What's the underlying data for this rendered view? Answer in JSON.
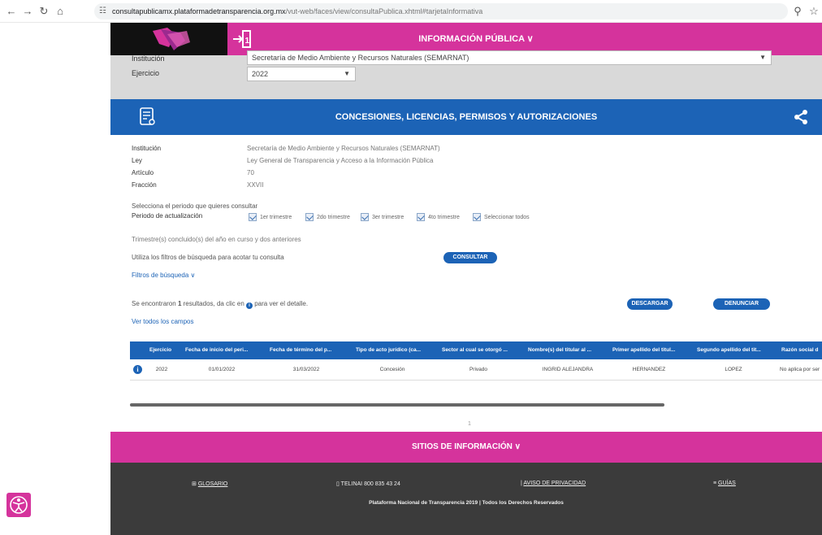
{
  "browser": {
    "url_host": "consultapublicamx.plataformadetransparencia.org.mx",
    "url_path": "/vut-web/faces/view/consultaPublica.xhtml#tarjetaInformativa"
  },
  "header": {
    "title": "INFORMACIÓN PÚBLICA ∨"
  },
  "filters": {
    "institucion_label": "Institución",
    "institucion_value": "Secretaría de Medio Ambiente y Recursos Naturales (SEMARNAT)",
    "ejercicio_label": "Ejercicio",
    "ejercicio_value": "2022"
  },
  "card": {
    "title": "CONCESIONES, LICENCIAS, PERMISOS Y AUTORIZACIONES",
    "institucion_k": "Institución",
    "institucion_v": "Secretaría de Medio Ambiente y Recursos Naturales (SEMARNAT)",
    "ley_k": "Ley",
    "ley_v": "Ley General de Transparencia y Acceso a la Información Pública",
    "articulo_k": "Artículo",
    "articulo_v": "70",
    "fraccion_k": "Fracción",
    "fraccion_v": "XXVII"
  },
  "period": {
    "prompt": "Selecciona el periodo que quieres consultar",
    "label": "Periodo de actualización",
    "options": [
      "1er trimestre",
      "2do trimestre",
      "3er trimestre",
      "4to trimestre",
      "Seleccionar todos"
    ],
    "note": "Trimestre(s) concluido(s) del año en curso y dos anteriores"
  },
  "search": {
    "hint": "Utiliza los filtros de búsqueda para acotar tu consulta",
    "consultar": "CONSULTAR",
    "filtros": "Filtros de búsqueda ∨"
  },
  "results": {
    "text_a": "Se encontraron ",
    "count": "1",
    "text_b": " resultados, da clic en ",
    "text_c": " para ver el detalle.",
    "ver_todos": "Ver todos los campos",
    "descargar": "DESCARGAR",
    "denunciar": "DENUNCIAR"
  },
  "table": {
    "headers": [
      "Ejercicio",
      "Fecha de inicio del peri...",
      "Fecha de término del p...",
      "Tipo de acto jurídico (ca...",
      "Sector al cual se otorgó ...",
      "Nombre(s) del titular al ...",
      "Primer apellido del titul...",
      "Segundo apellido del tit...",
      "Razón social d"
    ],
    "row": [
      "2022",
      "01/01/2022",
      "31/03/2022",
      "Concesión",
      "Privado",
      "INGRID ALEJANDRA",
      "HERNANDEZ",
      "LOPEZ",
      "No aplica por ser"
    ]
  },
  "pager": {
    "page": "1"
  },
  "footer": {
    "sitios": "SITIOS DE INFORMACIÓN ∨",
    "glosario": "GLOSARIO",
    "telinai": "TELINAI 800 835 43 24",
    "aviso": "AVISO DE PRIVACIDAD",
    "guias": "GUÍAS",
    "copyright": "Plataforma Nacional de Transparencia 2019 | Todos los Derechos Reservados"
  },
  "colors": {
    "pink": "#d5339c",
    "blue": "#1c63b6",
    "dark": "#3b3b3b"
  }
}
